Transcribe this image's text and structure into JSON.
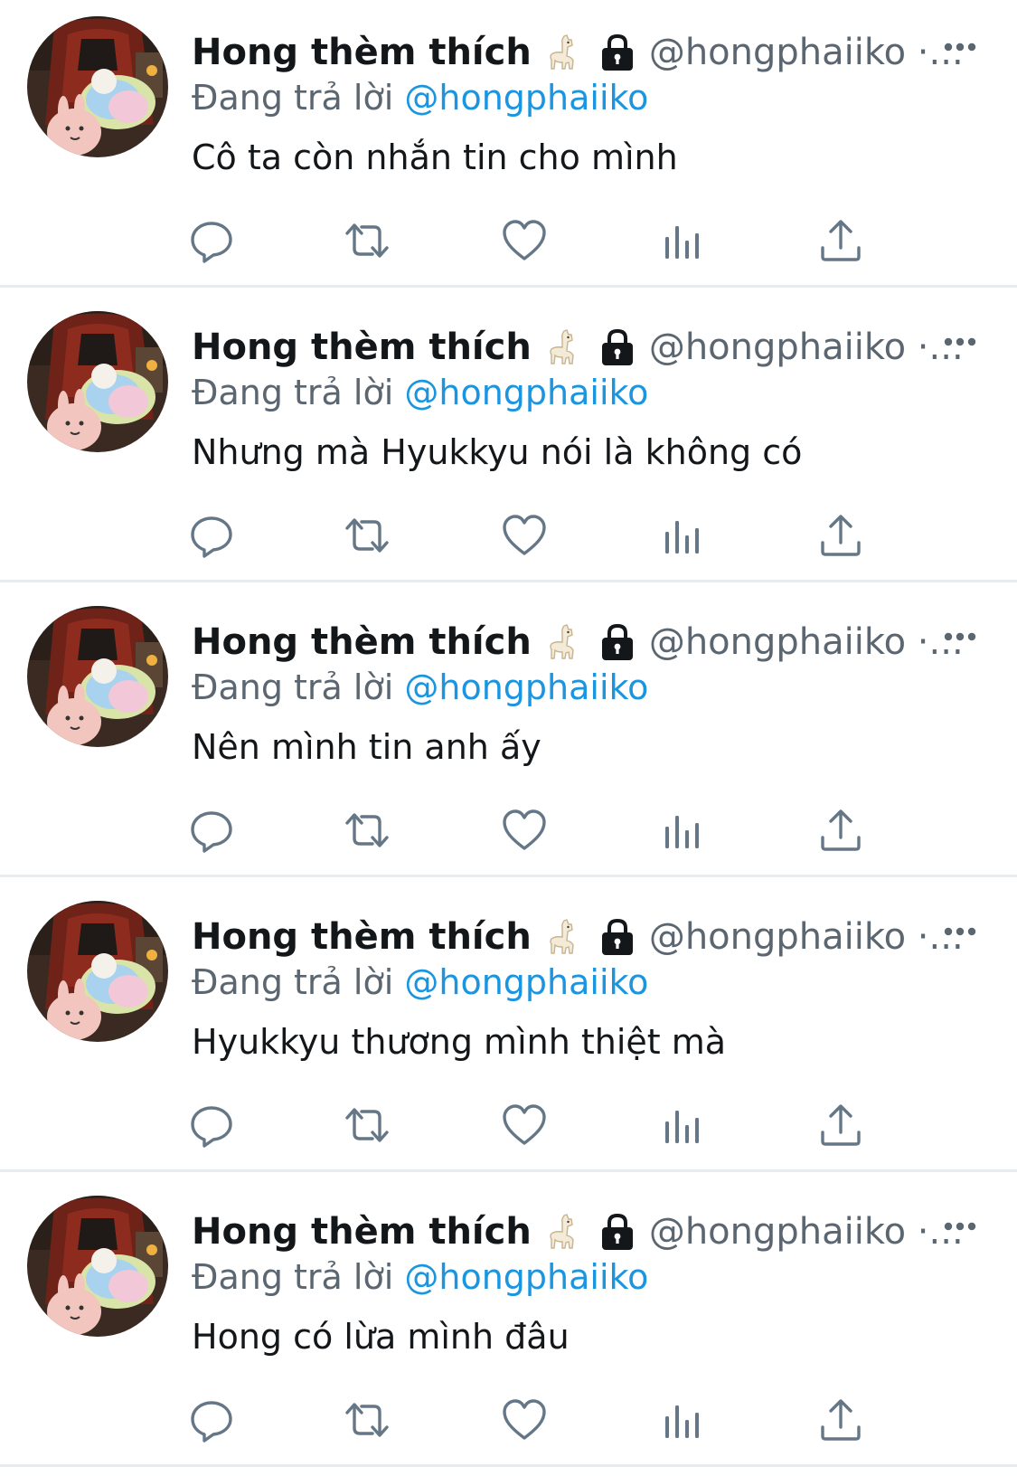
{
  "tweets": [
    {
      "author_name": "Hong thèm thích",
      "handle": "@hongphaiiko ·...",
      "reply_prefix": "Đang trả lời",
      "reply_to": "@hongphaiiko",
      "text": "Cô ta còn nhắn tin cho mình"
    },
    {
      "author_name": "Hong thèm thích",
      "handle": "@hongphaiiko ·...",
      "reply_prefix": "Đang trả lời",
      "reply_to": "@hongphaiiko",
      "text": "Nhưng mà Hyukkyu nói là không có"
    },
    {
      "author_name": "Hong thèm thích",
      "handle": "@hongphaiiko ·...",
      "reply_prefix": "Đang trả lời",
      "reply_to": "@hongphaiiko",
      "text": "Nên mình tin anh ấy"
    },
    {
      "author_name": "Hong thèm thích",
      "handle": "@hongphaiiko ·...",
      "reply_prefix": "Đang trả lời",
      "reply_to": "@hongphaiiko",
      "text": "Hyukkyu thương mình thiệt mà"
    },
    {
      "author_name": "Hong thèm thích",
      "handle": "@hongphaiiko ·...",
      "reply_prefix": "Đang trả lời",
      "reply_to": "@hongphaiiko",
      "text": "Hong có lừa mình đâu"
    }
  ],
  "icons": {
    "badge": "llama-icon",
    "protected": "lock-icon",
    "menu": "more-icon",
    "actions": [
      "reply-icon",
      "retweet-icon",
      "like-icon",
      "analytics-icon",
      "share-icon"
    ]
  },
  "colors": {
    "text_primary": "#14171a",
    "text_secondary": "#5b6670",
    "mention": "#1b95e0",
    "icon": "#657786",
    "divider": "#e6ecf0"
  }
}
